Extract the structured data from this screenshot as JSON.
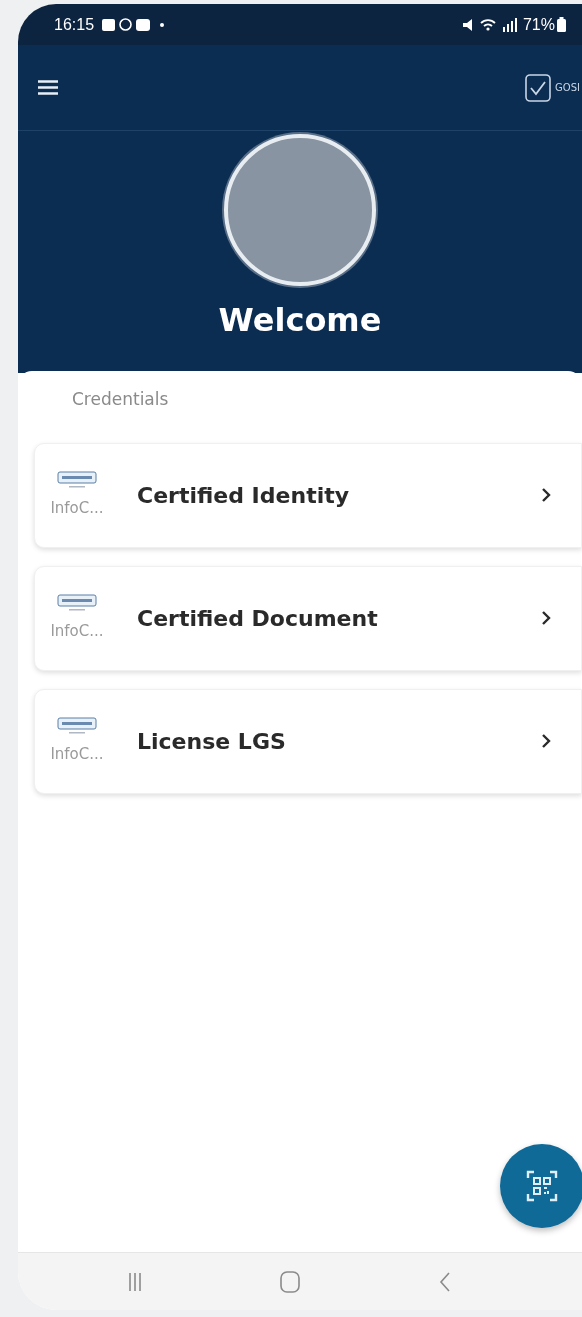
{
  "status_bar": {
    "time": "16:15",
    "battery": "71%"
  },
  "app_bar": {
    "brand": "GOSI"
  },
  "profile": {
    "greeting": "Welcome"
  },
  "section": {
    "title": "Credentials"
  },
  "credentials": [
    {
      "issuer": "InfoC...",
      "name": "Certified Identity"
    },
    {
      "issuer": "InfoC...",
      "name": "Certified Document"
    },
    {
      "issuer": "InfoC...",
      "name": "License LGS"
    }
  ]
}
